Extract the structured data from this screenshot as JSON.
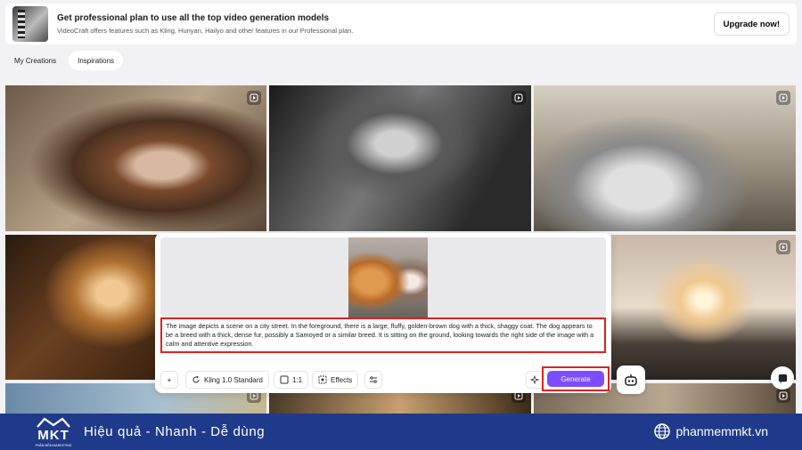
{
  "banner": {
    "title": "Get professional plan to use all the top video generation models",
    "subtitle": "VideoCraft offers features such as Kling, Hunyan, Hailyo and other features in our Professional plan.",
    "upgrade_label": "Upgrade now!"
  },
  "tabs": [
    {
      "label": "My Creations",
      "active": false
    },
    {
      "label": "Inspirations",
      "active": true
    }
  ],
  "prompt": {
    "text": "The image depicts a scene on a city street. In the foreground, there is a large, fluffy, golden-brown dog with a thick, shaggy coat. The dog appears to be a breed with a thick, dense fur, possibly a Samoyed or a similar breed. It is sitting on the ground, looking towards the right side of the image with a calm and attentive expression."
  },
  "toolbar": {
    "add_label": "+",
    "model_label": "Kling 1.0 Standard",
    "ratio_label": "1:1",
    "effects_label": "Effects",
    "generate_label": "Generate"
  },
  "footer": {
    "logo_text": "MKT",
    "logo_sub": "PHẦN MỀM MARKETING",
    "slogan": "Hiệu quả - Nhanh - Dễ dùng",
    "site": "phanmemmkt.vn"
  },
  "colors": {
    "accent": "#7c4dff",
    "highlight": "#e02020",
    "footer_bg": "#1f3a8a"
  }
}
